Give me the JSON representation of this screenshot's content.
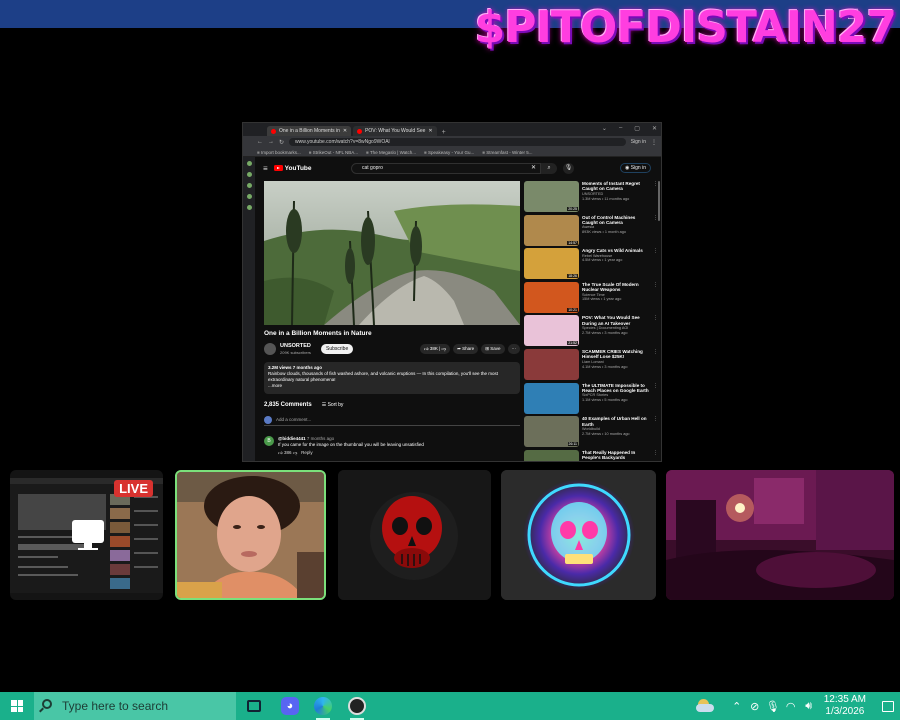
{
  "watermark": "$PITOFDISTAIN27",
  "browser": {
    "tabs": [
      {
        "label": "One in a Billion Moments in"
      },
      {
        "label": "POV: What You Would See"
      }
    ],
    "url": "www.youtube.com/watch?v=8wNgo9WOAl",
    "signin": "Sign in",
    "bookmarks": [
      "Import bookmarks...",
      "StrikeOut - NFL NBA...",
      "The Megaslo | Watch...",
      "Speakeasy - Your Gu...",
      "Streamfast - Winter 5..."
    ]
  },
  "youtube": {
    "logo": "YouTube",
    "search_value": "cat gopro",
    "signin": "Sign in",
    "video_title": "One in a Billion Moments in Nature",
    "channel": "UNSORTED",
    "subscribers": "209K subscribers",
    "subscribe": "Subscribe",
    "likes": "38K",
    "share": "Share",
    "save": "Save",
    "views_line": "3.2M views  7 months ago",
    "description": "Rainbow clouds, thousands of fish washed ashore, and volcanic eruptions — In this compilation, you'll see the most extraordinary natural phenomena!",
    "more": "...more",
    "comments_count": "2,835 Comments",
    "sort_by": "Sort by",
    "add_comment": "Add a comment...",
    "comment": {
      "author": "@biddie4441",
      "time": "7 months ago",
      "text": "If you came for the image on the thumbnail you will be leaving unsatisfied",
      "likes": "386",
      "reply": "Reply"
    }
  },
  "recs": [
    {
      "title": "Moments of Instant Regret Caught on Camera",
      "channel": "UNSORTED",
      "meta": "1.3M views • 11 months ago",
      "dur": "20:25",
      "color": "#7a8a6a"
    },
    {
      "title": "Out of Control Machines Caught on Camera",
      "channel": "Awesia",
      "meta": "893K views • 1 month ago",
      "dur": "14:57",
      "color": "#b0894c"
    },
    {
      "title": "Angry Cats vs Wild Animals",
      "channel": "Rebel Warehouse",
      "meta": "4.5M views • 1 year ago",
      "dur": "18:26",
      "color": "#d4a13b"
    },
    {
      "title": "The True Scale Of Modern Nuclear Weapons",
      "channel": "Science Time",
      "meta": "15M views • 1 year ago",
      "dur": "10:21",
      "color": "#d2571e"
    },
    {
      "title": "POV: What You Would See During an AI Takeover",
      "channel": "Species | Documenting AGI",
      "meta": "2.7M views • 3 months ago",
      "dur": "21:52",
      "color": "#e9c2d8"
    },
    {
      "title": "SCAMMER CRIES Watching Himself Lose $25K!",
      "channel": "Liam Lomani",
      "meta": "4.1M views • 3 months ago",
      "dur": "",
      "color": "#8a3a3a"
    },
    {
      "title": "The ULTIMATE Impossible to Reach Places on Google Earth",
      "channel": "SixPCR Stories",
      "meta": "1.1M views • 5 months ago",
      "dur": "",
      "color": "#2f7fb5"
    },
    {
      "title": "40 Examples of Urban Hell on Earth",
      "channel": "Worldbuild",
      "meta": "2.7M views • 10 months ago",
      "dur": "26:11",
      "color": "#6c6f5a"
    },
    {
      "title": "That Really Happened In People's Backyards",
      "channel": "",
      "meta": "",
      "dur": "",
      "color": "#556b44"
    }
  ],
  "tiles": {
    "live_badge": "LIVE"
  },
  "taskbar": {
    "search_placeholder": "Type here to search",
    "time": "12:35 AM",
    "date": "1/3/2026",
    "accent": "#1ab08b"
  }
}
